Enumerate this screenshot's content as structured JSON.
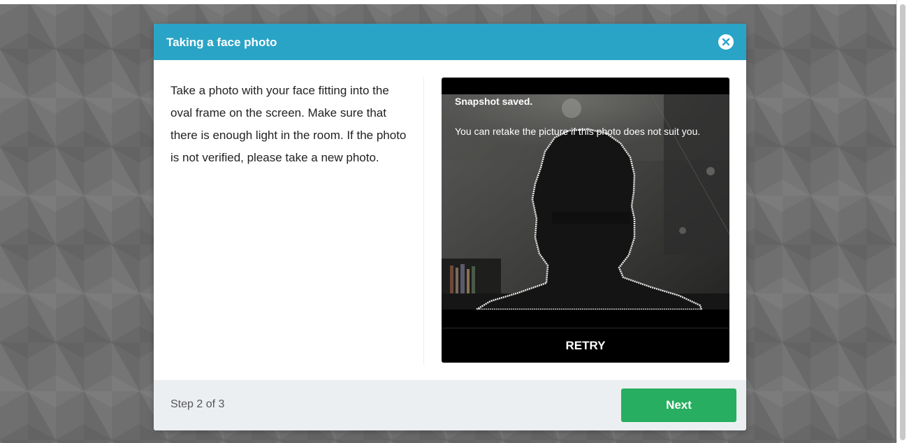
{
  "modal": {
    "title": "Taking a face photo",
    "close_icon": "close-circle-icon",
    "instructions": "Take a photo with your face fitting into the oval frame on the screen. Make sure that there is enough light in the room. If the photo is not verified, please take a new photo."
  },
  "camera": {
    "snapshot_title": "Snapshot saved.",
    "snapshot_message": "You can retake the picture if this photo does not suit you.",
    "retry_label": "RETRY"
  },
  "footer": {
    "step_text": "Step 2 of 3",
    "next_label": "Next"
  },
  "colors": {
    "header": "#2aa4c6",
    "next_button": "#27ae60",
    "footer": "#eceff2"
  }
}
